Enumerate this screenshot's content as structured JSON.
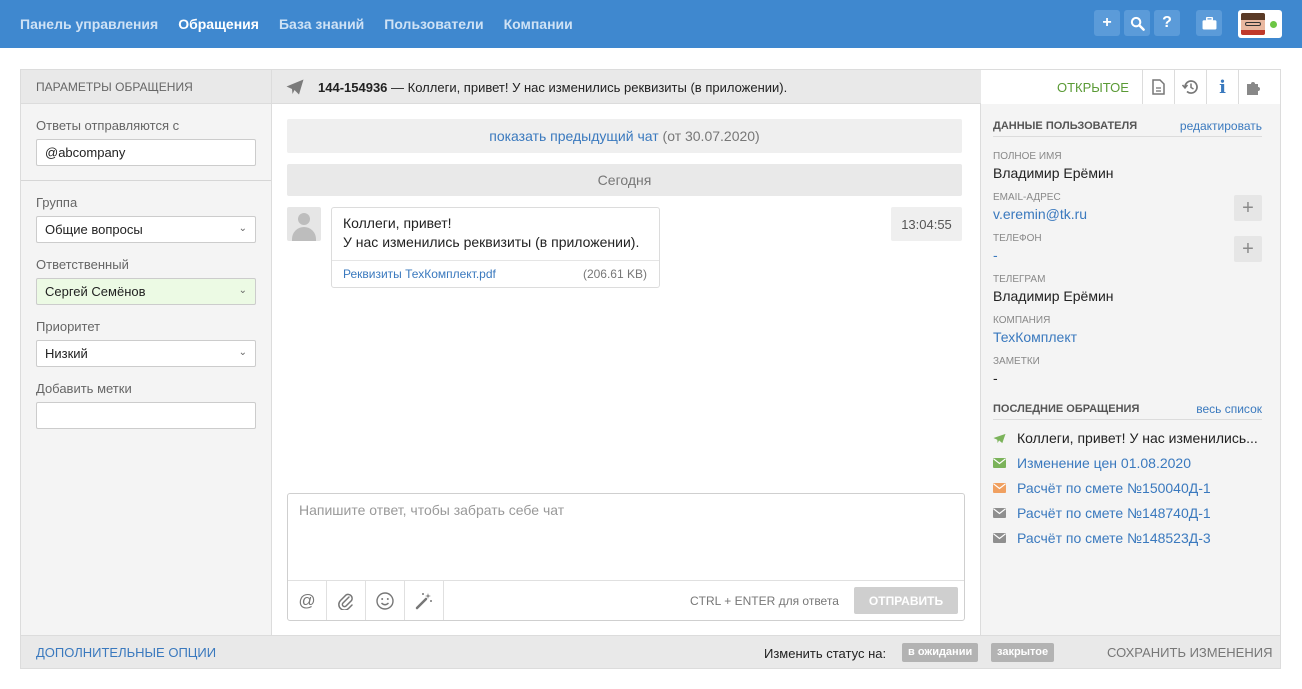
{
  "nav": {
    "items": [
      {
        "label": "Панель управления"
      },
      {
        "label": "Обращения"
      },
      {
        "label": "База знаний"
      },
      {
        "label": "Пользователи"
      },
      {
        "label": "Компании"
      }
    ],
    "active": "Обращения"
  },
  "topbar": {
    "icons": [
      "plus-icon",
      "search-icon",
      "help-icon",
      "briefcase-icon"
    ],
    "plus": "+",
    "help": "?"
  },
  "left": {
    "header": "ПАРАМЕТРЫ ОБРАЩЕНИЯ",
    "reply_from_label": "Ответы отправляются с",
    "reply_from_value": "@abcompany",
    "group_label": "Группа",
    "group_value": "Общие вопросы",
    "assignee_label": "Ответственный",
    "assignee_value": "Сергей Семёнов",
    "priority_label": "Приоритет",
    "priority_value": "Низкий",
    "tags_label": "Добавить метки",
    "tags_value": ""
  },
  "ticket": {
    "id": "144-154936",
    "dash": "—",
    "subject": "Коллеги, привет! У нас изменились реквизиты (в приложении).",
    "status": "ОТКРЫТОЕ",
    "header_icons": [
      "document-icon",
      "history-icon",
      "info-icon",
      "puzzle-icon"
    ]
  },
  "chat": {
    "prev_link": "показать предыдущий чат",
    "prev_date": "(от 30.07.2020)",
    "day_label": "Сегодня",
    "message": {
      "line1": "Коллеги, привет!",
      "line2": "У нас изменились реквизиты (в приложении).",
      "time": "13:04:55",
      "attachment_name": "Реквизиты ТехКомплект.pdf",
      "attachment_size": "(206.61 KB)"
    },
    "composer": {
      "placeholder": "Напишите ответ, чтобы забрать себе чат",
      "hint": "CTRL + ENTER для ответа",
      "send_label": "ОТПРАВИТЬ",
      "tools": [
        "mention-icon",
        "paperclip-icon",
        "emoji-icon",
        "magic-wand-icon"
      ]
    }
  },
  "user": {
    "section_title": "ДАННЫЕ ПОЛЬЗОВАТЕЛЯ",
    "edit_link": "редактировать",
    "full_name_label": "ПОЛНОЕ ИМЯ",
    "full_name": "Владимир Ерёмин",
    "email_label": "EMAIL-АДРЕС",
    "email": "v.eremin@tk.ru",
    "phone_label": "ТЕЛЕФОН",
    "phone": "-",
    "telegram_label": "ТЕЛЕГРАМ",
    "telegram": "Владимир Ерёмин",
    "company_label": "КОМПАНИЯ",
    "company": "ТехКомплект",
    "notes_label": "ЗАМЕТКИ",
    "notes": "-",
    "plus": "+"
  },
  "recent": {
    "section_title": "ПОСЛЕДНИЕ ОБРАЩЕНИЯ",
    "all_link": "весь список",
    "items": [
      {
        "text": "Коллеги, привет! У нас изменились...",
        "icon": "telegram-icon",
        "color": "#7bb35a"
      },
      {
        "text": "Изменение цен 01.08.2020",
        "icon": "mail-icon",
        "color": "#7bb35a"
      },
      {
        "text": "Расчёт по смете №150040Д-1",
        "icon": "mail-icon",
        "color": "#f0a060"
      },
      {
        "text": "Расчёт по смете №148740Д-1",
        "icon": "mail-icon",
        "color": "#8f8f8f"
      },
      {
        "text": "Расчёт по смете №148523Д-3",
        "icon": "mail-icon",
        "color": "#8f8f8f"
      }
    ]
  },
  "footer": {
    "more_options": "ДОПОЛНИТЕЛЬНЫЕ ОПЦИИ",
    "change_status": "Изменить статус на:",
    "status_pending": "в ожидании",
    "status_closed": "закрытое",
    "save": "СОХРАНИТЬ ИЗМЕНЕНИЯ"
  },
  "colors": {
    "topbar": "#3f88cf",
    "link": "#3a79be",
    "status_open": "#5a9a35",
    "assignee_bg": "#ecfae4"
  }
}
